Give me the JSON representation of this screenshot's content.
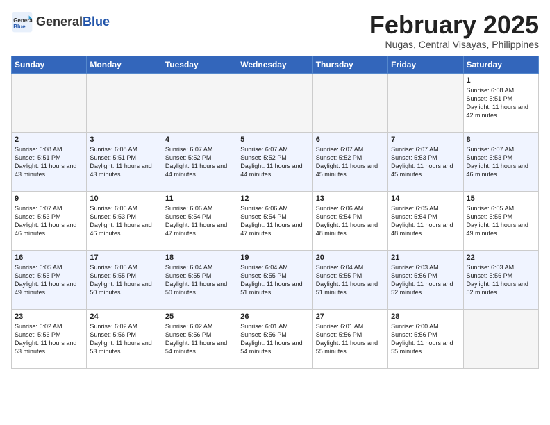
{
  "header": {
    "logo_general": "General",
    "logo_blue": "Blue",
    "month_year": "February 2025",
    "location": "Nugas, Central Visayas, Philippines"
  },
  "weekdays": [
    "Sunday",
    "Monday",
    "Tuesday",
    "Wednesday",
    "Thursday",
    "Friday",
    "Saturday"
  ],
  "weeks": [
    [
      {
        "day": "",
        "info": "",
        "empty": true
      },
      {
        "day": "",
        "info": "",
        "empty": true
      },
      {
        "day": "",
        "info": "",
        "empty": true
      },
      {
        "day": "",
        "info": "",
        "empty": true
      },
      {
        "day": "",
        "info": "",
        "empty": true
      },
      {
        "day": "",
        "info": "",
        "empty": true
      },
      {
        "day": "1",
        "info": "Sunrise: 6:08 AM\nSunset: 5:51 PM\nDaylight: 11 hours and 42 minutes.",
        "empty": false
      }
    ],
    [
      {
        "day": "2",
        "info": "Sunrise: 6:08 AM\nSunset: 5:51 PM\nDaylight: 11 hours and 43 minutes.",
        "empty": false
      },
      {
        "day": "3",
        "info": "Sunrise: 6:08 AM\nSunset: 5:51 PM\nDaylight: 11 hours and 43 minutes.",
        "empty": false
      },
      {
        "day": "4",
        "info": "Sunrise: 6:07 AM\nSunset: 5:52 PM\nDaylight: 11 hours and 44 minutes.",
        "empty": false
      },
      {
        "day": "5",
        "info": "Sunrise: 6:07 AM\nSunset: 5:52 PM\nDaylight: 11 hours and 44 minutes.",
        "empty": false
      },
      {
        "day": "6",
        "info": "Sunrise: 6:07 AM\nSunset: 5:52 PM\nDaylight: 11 hours and 45 minutes.",
        "empty": false
      },
      {
        "day": "7",
        "info": "Sunrise: 6:07 AM\nSunset: 5:53 PM\nDaylight: 11 hours and 45 minutes.",
        "empty": false
      },
      {
        "day": "8",
        "info": "Sunrise: 6:07 AM\nSunset: 5:53 PM\nDaylight: 11 hours and 46 minutes.",
        "empty": false
      }
    ],
    [
      {
        "day": "9",
        "info": "Sunrise: 6:07 AM\nSunset: 5:53 PM\nDaylight: 11 hours and 46 minutes.",
        "empty": false
      },
      {
        "day": "10",
        "info": "Sunrise: 6:06 AM\nSunset: 5:53 PM\nDaylight: 11 hours and 46 minutes.",
        "empty": false
      },
      {
        "day": "11",
        "info": "Sunrise: 6:06 AM\nSunset: 5:54 PM\nDaylight: 11 hours and 47 minutes.",
        "empty": false
      },
      {
        "day": "12",
        "info": "Sunrise: 6:06 AM\nSunset: 5:54 PM\nDaylight: 11 hours and 47 minutes.",
        "empty": false
      },
      {
        "day": "13",
        "info": "Sunrise: 6:06 AM\nSunset: 5:54 PM\nDaylight: 11 hours and 48 minutes.",
        "empty": false
      },
      {
        "day": "14",
        "info": "Sunrise: 6:05 AM\nSunset: 5:54 PM\nDaylight: 11 hours and 48 minutes.",
        "empty": false
      },
      {
        "day": "15",
        "info": "Sunrise: 6:05 AM\nSunset: 5:55 PM\nDaylight: 11 hours and 49 minutes.",
        "empty": false
      }
    ],
    [
      {
        "day": "16",
        "info": "Sunrise: 6:05 AM\nSunset: 5:55 PM\nDaylight: 11 hours and 49 minutes.",
        "empty": false
      },
      {
        "day": "17",
        "info": "Sunrise: 6:05 AM\nSunset: 5:55 PM\nDaylight: 11 hours and 50 minutes.",
        "empty": false
      },
      {
        "day": "18",
        "info": "Sunrise: 6:04 AM\nSunset: 5:55 PM\nDaylight: 11 hours and 50 minutes.",
        "empty": false
      },
      {
        "day": "19",
        "info": "Sunrise: 6:04 AM\nSunset: 5:55 PM\nDaylight: 11 hours and 51 minutes.",
        "empty": false
      },
      {
        "day": "20",
        "info": "Sunrise: 6:04 AM\nSunset: 5:55 PM\nDaylight: 11 hours and 51 minutes.",
        "empty": false
      },
      {
        "day": "21",
        "info": "Sunrise: 6:03 AM\nSunset: 5:56 PM\nDaylight: 11 hours and 52 minutes.",
        "empty": false
      },
      {
        "day": "22",
        "info": "Sunrise: 6:03 AM\nSunset: 5:56 PM\nDaylight: 11 hours and 52 minutes.",
        "empty": false
      }
    ],
    [
      {
        "day": "23",
        "info": "Sunrise: 6:02 AM\nSunset: 5:56 PM\nDaylight: 11 hours and 53 minutes.",
        "empty": false
      },
      {
        "day": "24",
        "info": "Sunrise: 6:02 AM\nSunset: 5:56 PM\nDaylight: 11 hours and 53 minutes.",
        "empty": false
      },
      {
        "day": "25",
        "info": "Sunrise: 6:02 AM\nSunset: 5:56 PM\nDaylight: 11 hours and 54 minutes.",
        "empty": false
      },
      {
        "day": "26",
        "info": "Sunrise: 6:01 AM\nSunset: 5:56 PM\nDaylight: 11 hours and 54 minutes.",
        "empty": false
      },
      {
        "day": "27",
        "info": "Sunrise: 6:01 AM\nSunset: 5:56 PM\nDaylight: 11 hours and 55 minutes.",
        "empty": false
      },
      {
        "day": "28",
        "info": "Sunrise: 6:00 AM\nSunset: 5:56 PM\nDaylight: 11 hours and 55 minutes.",
        "empty": false
      },
      {
        "day": "",
        "info": "",
        "empty": true
      }
    ]
  ]
}
